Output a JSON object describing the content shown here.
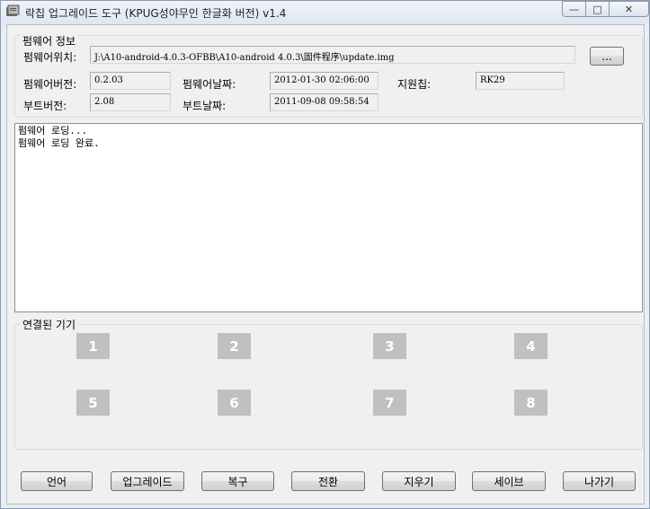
{
  "window": {
    "title": "락칩 업그레이드 도구 (KPUG성야무인 한글화 버전) v1.4",
    "caption": {
      "minimize": "—",
      "maximize": "□",
      "close": "✕"
    }
  },
  "firmware_info": {
    "group_label": "펌웨어 정보",
    "location_label": "펌웨어위치:",
    "location_value": "J:\\A10-android-4.0.3-OFBB\\A10-android 4.0.3\\固件程序\\update.img",
    "browse_label": "...",
    "version_label": "펌웨어버전:",
    "version_value": "0.2.03",
    "date_label": "펌웨어날짜:",
    "date_value": "2012-01-30 02:06:00",
    "chip_label": "지원칩:",
    "chip_value": "RK29",
    "boot_version_label": "부트버전:",
    "boot_version_value": "2.08",
    "boot_date_label": "부트날짜:",
    "boot_date_value": "2011-09-08 09:58:54"
  },
  "log": {
    "lines": [
      "펌웨어 로딩...",
      "펌웨어 로딩 완료."
    ]
  },
  "devices": {
    "group_label": "연결된 기기",
    "slots": [
      "1",
      "2",
      "3",
      "4",
      "5",
      "6",
      "7",
      "8"
    ]
  },
  "buttons": {
    "language": "언어",
    "upgrade": "업그레이드",
    "restore": "복구",
    "switch": "전환",
    "erase": "지우기",
    "save": "세이브",
    "exit": "나가기"
  }
}
